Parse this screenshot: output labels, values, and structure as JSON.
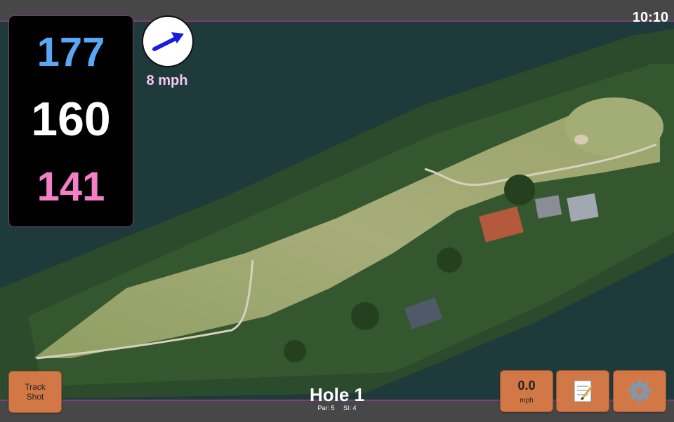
{
  "status": {
    "time": "10:10"
  },
  "distances": {
    "back": "177",
    "middle": "160",
    "front": "141"
  },
  "wind": {
    "speed": "8 mph",
    "icon": "arrow-icon"
  },
  "hole": {
    "title": "Hole 1",
    "par": "Par: 5",
    "si": "SI: 4"
  },
  "buttons": {
    "track_shot_line1": "Track",
    "track_shot_line2": "Shot",
    "speed_value": "0.0",
    "speed_unit": "mph",
    "notes_icon": "notepad-icon",
    "settings_icon": "gear-icon"
  },
  "colors": {
    "back_distance": "#5aa8f5",
    "middle_distance": "#ffffff",
    "front_distance": "#f47fc4",
    "button": "#d17846",
    "wind_text": "#f6c8f3",
    "accent_border": "#7a3f7a"
  }
}
